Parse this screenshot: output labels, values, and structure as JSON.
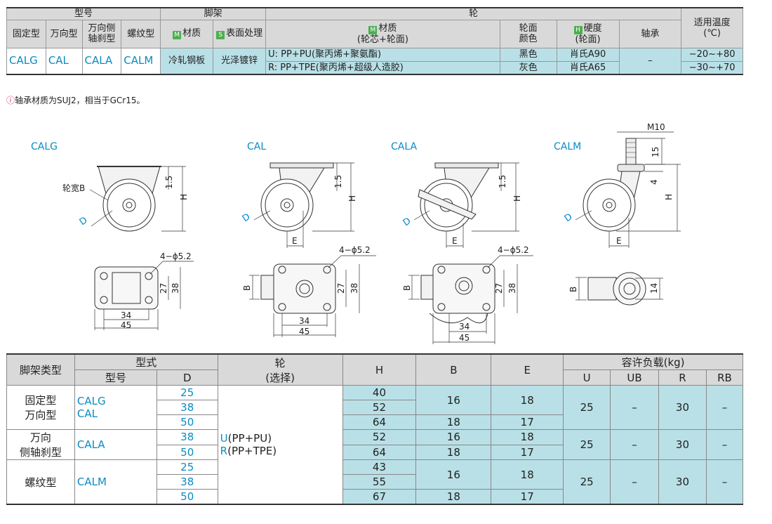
{
  "spec_table": {
    "hdr_model": "型号",
    "hdr_frame": "脚架",
    "hdr_wheel": "轮",
    "hdr_temp": "适用温度",
    "hdr_temp_unit": "(℃)",
    "hdr_fixed": "固定型",
    "hdr_swivel": "万向型",
    "hdr_side_brake": "万向侧",
    "hdr_side_brake2": "轴刹型",
    "hdr_thread": "螺纹型",
    "mark_m": "M",
    "mark_s": "S",
    "mark_h": "H",
    "hdr_material": "材质",
    "hdr_surface": "表面处理",
    "hdr_wheel_material": "材质",
    "hdr_wheel_material2": "(轮芯+轮面)",
    "hdr_face_color": "轮面",
    "hdr_face_color2": "颜色",
    "hdr_hardness": "硬度",
    "hdr_hardness2": "(轮面)",
    "hdr_bearing": "轴承",
    "code_calg": "CALG",
    "code_cal": "CAL",
    "code_cala": "CALA",
    "code_calm": "CALM",
    "frame_material": "冷轧钢板",
    "frame_surface": "光泽镀锌",
    "bearing": "–",
    "rows": [
      {
        "material": "U: PP+PU(聚丙烯+聚氨酯)",
        "color": "黑色",
        "hardness": "肖氏A90",
        "temp": "−20~+80"
      },
      {
        "material": "R: PP+TPE(聚丙烯+超级人造胶)",
        "color": "灰色",
        "hardness": "肖氏A65",
        "temp": "−30~+70"
      }
    ]
  },
  "note": {
    "icon": "warning-icon",
    "text": "轴承材质为SUJ2，相当于GCr15。"
  },
  "drawings": {
    "names": [
      "CALG",
      "CAL",
      "CALA",
      "CALM"
    ],
    "wheel_width_label": "轮宽B",
    "d": "D",
    "h": "H",
    "e": "E",
    "b": "B",
    "dim_15": "1.5",
    "dim_4": "4",
    "m10": "M10",
    "dim_15b": "15",
    "dim_14": "14",
    "holes": "4−ϕ5.2",
    "dim_27": "27",
    "dim_38": "38",
    "dim_34": "34",
    "dim_45": "45"
  },
  "load_table": {
    "hdr_frame_type": "脚架类型",
    "hdr_type": "型式",
    "hdr_model": "型号",
    "hdr_d": "D",
    "hdr_wheel": "轮",
    "hdr_wheel_sel": "(选择)",
    "hdr_h": "H",
    "hdr_b": "B",
    "hdr_e": "E",
    "hdr_load": "容许负载(kg)",
    "hdr_u": "U",
    "hdr_ub": "UB",
    "hdr_r": "R",
    "hdr_rb": "RB",
    "g1_type": "固定型",
    "g1_type2": "万向型",
    "g1_code": "CALG",
    "g1_code2": "CAL",
    "g2_type": "万向",
    "g2_type2": "侧轴刹型",
    "g2_code": "CALA",
    "g3_type": "螺纹型",
    "g3_code": "CALM",
    "wheel_u_key": "U",
    "wheel_u_val": "(PP+PU)",
    "wheel_r_key": "R",
    "wheel_r_val": "(PP+TPE)",
    "d_values": [
      "25",
      "38",
      "50",
      "38",
      "50",
      "25",
      "38",
      "50"
    ],
    "h_values": [
      "40",
      "52",
      "64",
      "52",
      "64",
      "43",
      "55",
      "67"
    ],
    "b_values": [
      "16",
      "18",
      "16",
      "18",
      "16",
      "18"
    ],
    "e_values": [
      "18",
      "17",
      "18",
      "17",
      "18",
      "17"
    ],
    "u": "25",
    "ub": "–",
    "r": "30",
    "rb": "–"
  }
}
